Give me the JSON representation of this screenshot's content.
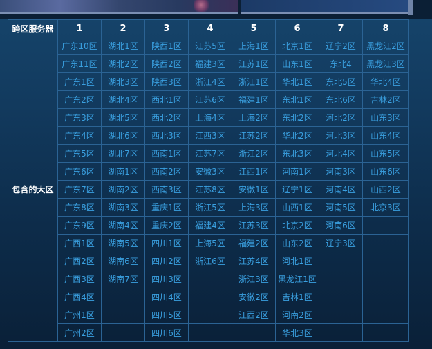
{
  "header": {
    "corner_label": "跨区服务器",
    "columns": [
      "1",
      "2",
      "3",
      "4",
      "5",
      "6",
      "7",
      "8"
    ]
  },
  "group_label": "包含的大区",
  "rows": [
    [
      "广东10区",
      "湖北1区",
      "陕西1区",
      "江苏5区",
      "上海1区",
      "北京1区",
      "辽宁2区",
      "黑龙江2区"
    ],
    [
      "广东11区",
      "湖北2区",
      "陕西2区",
      "福建3区",
      "江苏1区",
      "山东1区",
      "东北4",
      "黑龙江3区"
    ],
    [
      "广东1区",
      "湖北3区",
      "陕西3区",
      "浙江4区",
      "浙江1区",
      "华北1区",
      "东北5区",
      "华北4区"
    ],
    [
      "广东2区",
      "湖北4区",
      "西北1区",
      "江苏6区",
      "福建1区",
      "东北1区",
      "东北6区",
      "吉林2区"
    ],
    [
      "广东3区",
      "湖北5区",
      "西北2区",
      "上海4区",
      "上海2区",
      "东北2区",
      "河北2区",
      "山东3区"
    ],
    [
      "广东4区",
      "湖北6区",
      "西北3区",
      "江西3区",
      "江苏2区",
      "华北2区",
      "河北3区",
      "山东4区"
    ],
    [
      "广东5区",
      "湖北7区",
      "西南1区",
      "江苏7区",
      "浙江2区",
      "东北3区",
      "河北4区",
      "山东5区"
    ],
    [
      "广东6区",
      "湖南1区",
      "西南2区",
      "安徽3区",
      "江西1区",
      "河南1区",
      "河南3区",
      "山东6区"
    ],
    [
      "广东7区",
      "湖南2区",
      "西南3区",
      "江苏8区",
      "安徽1区",
      "辽宁1区",
      "河南4区",
      "山西2区"
    ],
    [
      "广东8区",
      "湖南3区",
      "重庆1区",
      "浙江5区",
      "上海3区",
      "山西1区",
      "河南5区",
      "北京3区"
    ],
    [
      "广东9区",
      "湖南4区",
      "重庆2区",
      "福建4区",
      "江苏3区",
      "北京2区",
      "河南6区",
      ""
    ],
    [
      "广西1区",
      "湖南5区",
      "四川1区",
      "上海5区",
      "福建2区",
      "山东2区",
      "辽宁3区",
      ""
    ],
    [
      "广西2区",
      "湖南6区",
      "四川2区",
      "浙江6区",
      "江苏4区",
      "河北1区",
      "",
      ""
    ],
    [
      "广西3区",
      "湖南7区",
      "四川3区",
      "",
      "浙江3区",
      "黑龙江1区",
      "",
      ""
    ],
    [
      "广西4区",
      "",
      "四川4区",
      "",
      "安徽2区",
      "吉林1区",
      "",
      ""
    ],
    [
      "广州1区",
      "",
      "四川5区",
      "",
      "江西2区",
      "河南2区",
      "",
      ""
    ],
    [
      "广州2区",
      "",
      "四川6区",
      "",
      "",
      "华北3区",
      "",
      ""
    ]
  ],
  "colors": {
    "cell_text": "#3aa0e0",
    "header_text": "#ffffff",
    "grid_line": "#2b6394"
  }
}
